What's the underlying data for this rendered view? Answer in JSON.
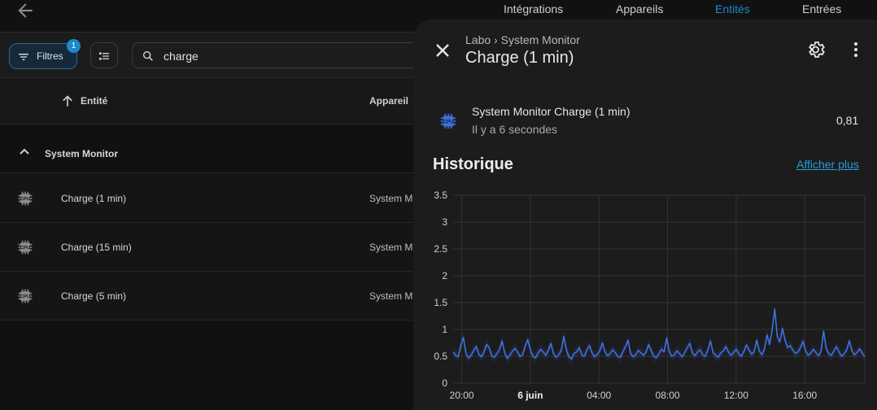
{
  "top_tabs": [
    {
      "label": "Intégrations",
      "active": false
    },
    {
      "label": "Appareils",
      "active": false
    },
    {
      "label": "Entités",
      "active": true
    },
    {
      "label": "Entrées",
      "active": false
    }
  ],
  "toolbar": {
    "filters_label": "Filtres",
    "filters_badge": "1",
    "search_value": "charge"
  },
  "table": {
    "columns": [
      "Entité",
      "Appareil"
    ],
    "group": "System Monitor",
    "rows": [
      {
        "name": "Charge (1 min)",
        "device": "System M"
      },
      {
        "name": "Charge (15 min)",
        "device": "System M"
      },
      {
        "name": "Charge (5 min)",
        "device": "System M"
      }
    ]
  },
  "dialog": {
    "breadcrumb_area": "Labo",
    "breadcrumb_separator": "›",
    "breadcrumb_device": "System Monitor",
    "title": "Charge (1 min)",
    "entity_name": "System Monitor Charge (1 min)",
    "last_changed": "Il y a 6 secondes",
    "state": "0,81",
    "history_title": "Historique",
    "show_more": "Afficher plus"
  },
  "colors": {
    "accent": "#1e88c9",
    "series": "#3f6fe0",
    "background": "#111111",
    "dialog": "#1c1c1c"
  },
  "chart_data": {
    "type": "line",
    "ylim": [
      0,
      3.5
    ],
    "y_ticks": [
      "0",
      "0.5",
      "1",
      "1.5",
      "2",
      "2.5",
      "3",
      "3.5"
    ],
    "x_ticks": [
      {
        "label": "20:00",
        "bold": false
      },
      {
        "label": "6 juin",
        "bold": true
      },
      {
        "label": "04:00",
        "bold": false
      },
      {
        "label": "08:00",
        "bold": false
      },
      {
        "label": "12:00",
        "bold": false
      },
      {
        "label": "16:00",
        "bold": false
      }
    ],
    "x_start_hour": 19.5,
    "x_end_hour": 43.5,
    "x_tick_hours": [
      20,
      24,
      28,
      32,
      36,
      40
    ],
    "grid": true,
    "series": [
      {
        "values": [
          0.58,
          0.52,
          0.49,
          0.71,
          0.85,
          0.55,
          0.47,
          0.52,
          0.61,
          0.68,
          0.54,
          0.49,
          0.58,
          0.72,
          0.66,
          0.51,
          0.48,
          0.55,
          0.62,
          0.79,
          0.57,
          0.46,
          0.52,
          0.59,
          0.65,
          0.58,
          0.5,
          0.53,
          0.69,
          0.81,
          0.62,
          0.5,
          0.47,
          0.56,
          0.63,
          0.58,
          0.52,
          0.61,
          0.74,
          0.55,
          0.48,
          0.53,
          0.6,
          0.87,
          0.62,
          0.49,
          0.45,
          0.55,
          0.58,
          0.66,
          0.53,
          0.5,
          0.62,
          0.7,
          0.56,
          0.49,
          0.54,
          0.6,
          0.75,
          0.58,
          0.51,
          0.55,
          0.62,
          0.57,
          0.5,
          0.48,
          0.59,
          0.68,
          0.8,
          0.55,
          0.49,
          0.53,
          0.61,
          0.56,
          0.52,
          0.58,
          0.72,
          0.6,
          0.5,
          0.47,
          0.55,
          0.63,
          0.58,
          0.84,
          0.59,
          0.5,
          0.53,
          0.6,
          0.55,
          0.49,
          0.57,
          0.66,
          0.74,
          0.56,
          0.51,
          0.58,
          0.62,
          0.53,
          0.5,
          0.61,
          0.79,
          0.57,
          0.52,
          0.48,
          0.56,
          0.6,
          0.68,
          0.58,
          0.52,
          0.57,
          0.63,
          0.55,
          0.5,
          0.59,
          0.71,
          0.62,
          0.54,
          0.58,
          0.8,
          0.6,
          0.53,
          0.63,
          0.9,
          0.72,
          1.0,
          1.38,
          0.86,
          0.77,
          1.02,
          0.8,
          0.66,
          0.7,
          0.62,
          0.55,
          0.58,
          0.66,
          0.78,
          0.6,
          0.52,
          0.56,
          0.63,
          0.57,
          0.51,
          0.59,
          0.97,
          0.64,
          0.55,
          0.52,
          0.6,
          0.68,
          0.58,
          0.5,
          0.55,
          0.62,
          0.79,
          0.6,
          0.53,
          0.57,
          0.64,
          0.56,
          0.5
        ]
      }
    ]
  }
}
